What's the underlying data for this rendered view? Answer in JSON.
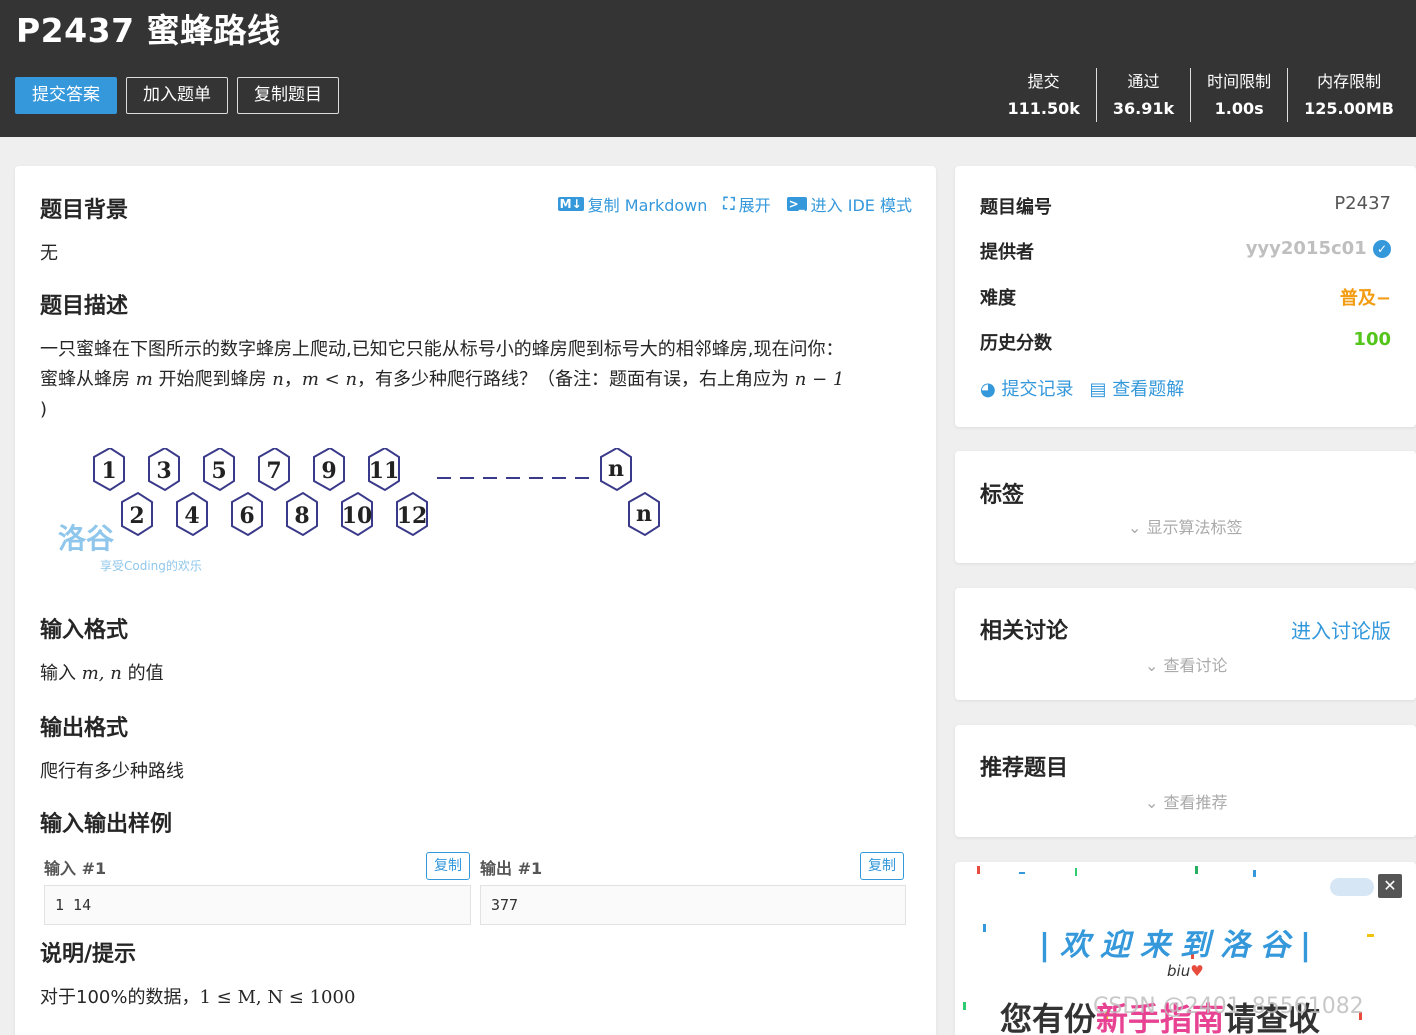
{
  "header": {
    "title": "P2437 蜜蜂路线",
    "buttons": {
      "submit": "提交答案",
      "add_list": "加入题单",
      "copy": "复制题目"
    },
    "stats": [
      {
        "label": "提交",
        "value": "111.50k"
      },
      {
        "label": "通过",
        "value": "36.91k"
      },
      {
        "label": "时间限制",
        "value": "1.00s"
      },
      {
        "label": "内存限制",
        "value": "125.00MB"
      }
    ]
  },
  "toolbar": {
    "copy_md": "复制 Markdown",
    "expand": "展开",
    "ide": "进入 IDE 模式"
  },
  "sections": {
    "background_title": "题目背景",
    "background_text": "无",
    "desc_title": "题目描述",
    "desc_line1": "一只蜜蜂在下图所示的数字蜂房上爬动,已知它只能从标号小的蜂房爬到标号大的相邻蜂房,现在问你：",
    "desc_l2a": "蜜蜂从蜂房 ",
    "desc_m": "m",
    "desc_l2b": " 开始爬到蜂房 ",
    "desc_n": "n",
    "desc_comma": "，",
    "desc_cond": "m < n",
    "desc_l2c": "，有多少种爬行路线？（备注：题面有误，右上角应为 ",
    "desc_formula": "n − 1",
    "desc_line3": ")",
    "input_title": "输入格式",
    "input_text_a": "输入 ",
    "input_vars": "m, n",
    "input_text_b": " 的值",
    "output_title": "输出格式",
    "output_text": "爬行有多少种路线",
    "sample_title": "输入输出样例",
    "hint_title": "说明/提示",
    "hint_text_a": "对于100%的数据，",
    "hint_formula": "1 ≤ M, N ≤ 1000"
  },
  "figure": {
    "top_row": [
      "1",
      "3",
      "5",
      "7",
      "9",
      "11"
    ],
    "bottom_row": [
      "2",
      "4",
      "6",
      "8",
      "10",
      "12"
    ],
    "end_top": "n",
    "end_bottom": "n",
    "watermark": "洛谷",
    "watermark_sub": "享受Coding的欢乐"
  },
  "samples": {
    "input_label": "输入 #1",
    "output_label": "输出 #1",
    "copy_label": "复制",
    "input_value": "1 14",
    "output_value": "377"
  },
  "info": {
    "id_key": "题目编号",
    "id_val": "P2437",
    "provider_key": "提供者",
    "provider_val": "yyy2015c01",
    "difficulty_key": "难度",
    "difficulty_val": "普及−",
    "score_key": "历史分数",
    "score_val": "100",
    "records": "提交记录",
    "solutions": "查看题解",
    "colors": {
      "difficulty": "#f39c11",
      "score": "#52c41a",
      "provider": "#bfbfbf"
    }
  },
  "tags": {
    "title": "标签",
    "toggle": "显示算法标签"
  },
  "discuss": {
    "title": "相关讨论",
    "enter": "进入讨论版",
    "toggle": "查看讨论"
  },
  "recommend": {
    "title": "推荐题目",
    "toggle": "查看推荐"
  },
  "banner": {
    "welcome": "|欢迎来到洛谷|",
    "biu": "biu",
    "bottom_a": "您有份",
    "bottom_b": "新手指南",
    "bottom_c": "请查收",
    "watermark": "CSDN @2401_85561082"
  }
}
